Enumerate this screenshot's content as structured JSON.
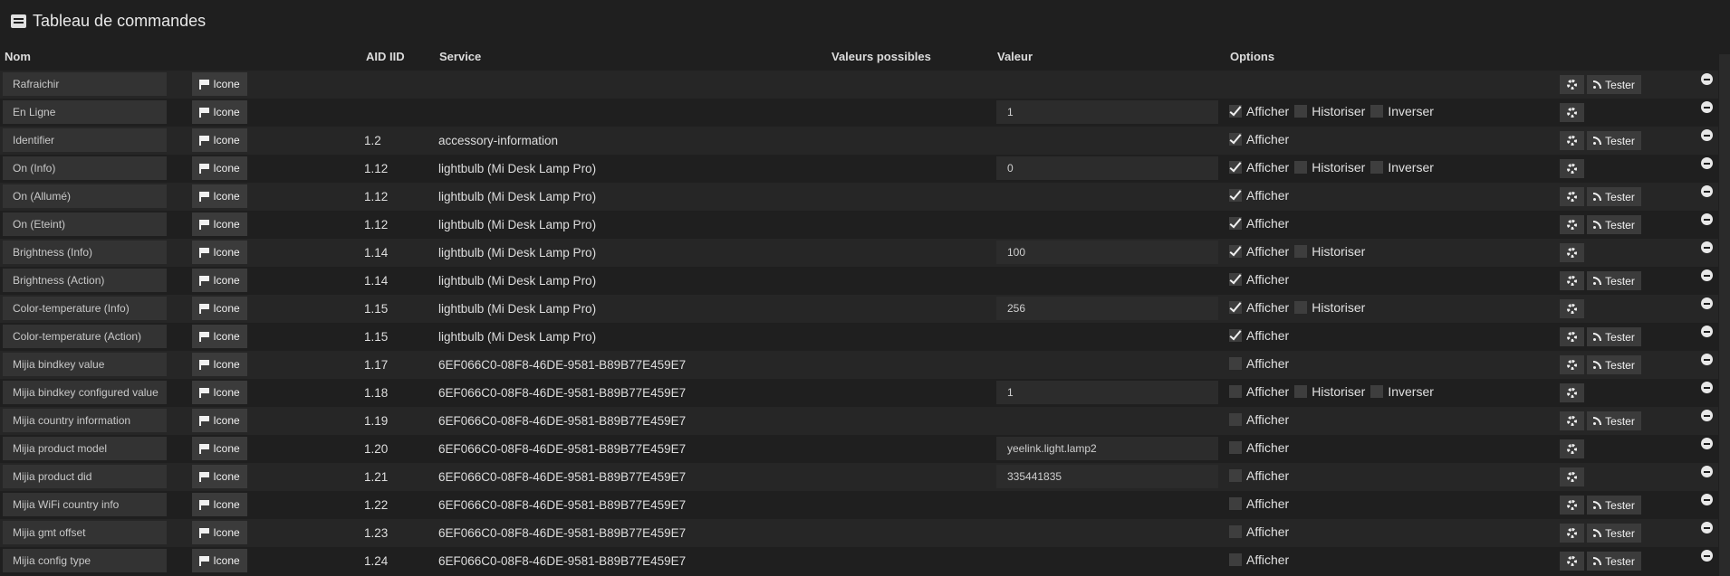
{
  "page": {
    "title": "Tableau de commandes",
    "title_icon": "list-icon"
  },
  "columns": {
    "name": "Nom",
    "aid": "AID IID",
    "service": "Service",
    "possible": "Valeurs possibles",
    "value": "Valeur",
    "options": "Options"
  },
  "labels": {
    "icon_button": "Icone",
    "test_button": "Tester",
    "afficher": "Afficher",
    "historiser": "Historiser",
    "inverser": "Inverser"
  },
  "rows": [
    {
      "name": "Rafraichir",
      "aid": "",
      "service": "",
      "value": null,
      "afficher": null,
      "historiser": null,
      "inverser": null,
      "test": true
    },
    {
      "name": "En Ligne",
      "aid": "",
      "service": "",
      "value": "1",
      "afficher": true,
      "historiser": false,
      "inverser": false,
      "test": false
    },
    {
      "name": "Identifier",
      "aid": "1.2",
      "service": "accessory-information",
      "value": null,
      "afficher": true,
      "historiser": null,
      "inverser": null,
      "test": true
    },
    {
      "name": "On (Info)",
      "aid": "1.12",
      "service": "lightbulb (Mi Desk Lamp Pro)",
      "value": "0",
      "afficher": true,
      "historiser": false,
      "inverser": false,
      "test": false
    },
    {
      "name": "On (Allumé)",
      "aid": "1.12",
      "service": "lightbulb (Mi Desk Lamp Pro)",
      "value": null,
      "afficher": true,
      "historiser": null,
      "inverser": null,
      "test": true
    },
    {
      "name": "On (Eteint)",
      "aid": "1.12",
      "service": "lightbulb (Mi Desk Lamp Pro)",
      "value": null,
      "afficher": true,
      "historiser": null,
      "inverser": null,
      "test": true
    },
    {
      "name": "Brightness (Info)",
      "aid": "1.14",
      "service": "lightbulb (Mi Desk Lamp Pro)",
      "value": "100",
      "afficher": true,
      "historiser": false,
      "inverser": null,
      "test": false
    },
    {
      "name": "Brightness (Action)",
      "aid": "1.14",
      "service": "lightbulb (Mi Desk Lamp Pro)",
      "value": null,
      "afficher": true,
      "historiser": null,
      "inverser": null,
      "test": true
    },
    {
      "name": "Color-temperature (Info)",
      "aid": "1.15",
      "service": "lightbulb (Mi Desk Lamp Pro)",
      "value": "256",
      "afficher": true,
      "historiser": false,
      "inverser": null,
      "test": false
    },
    {
      "name": "Color-temperature (Action)",
      "aid": "1.15",
      "service": "lightbulb (Mi Desk Lamp Pro)",
      "value": null,
      "afficher": true,
      "historiser": null,
      "inverser": null,
      "test": true
    },
    {
      "name": "Mijia bindkey value",
      "aid": "1.17",
      "service": "6EF066C0-08F8-46DE-9581-B89B77E459E7",
      "value": null,
      "afficher": false,
      "historiser": null,
      "inverser": null,
      "test": true
    },
    {
      "name": "Mijia bindkey configured value",
      "aid": "1.18",
      "service": "6EF066C0-08F8-46DE-9581-B89B77E459E7",
      "value": "1",
      "afficher": false,
      "historiser": false,
      "inverser": false,
      "test": false
    },
    {
      "name": "Mijia country information",
      "aid": "1.19",
      "service": "6EF066C0-08F8-46DE-9581-B89B77E459E7",
      "value": null,
      "afficher": false,
      "historiser": null,
      "inverser": null,
      "test": true
    },
    {
      "name": "Mijia product model",
      "aid": "1.20",
      "service": "6EF066C0-08F8-46DE-9581-B89B77E459E7",
      "value": "yeelink.light.lamp2",
      "afficher": false,
      "historiser": null,
      "inverser": null,
      "test": false
    },
    {
      "name": "Mijia product did",
      "aid": "1.21",
      "service": "6EF066C0-08F8-46DE-9581-B89B77E459E7",
      "value": "335441835",
      "afficher": false,
      "historiser": null,
      "inverser": null,
      "test": false
    },
    {
      "name": "Mijia WiFi country info",
      "aid": "1.22",
      "service": "6EF066C0-08F8-46DE-9581-B89B77E459E7",
      "value": null,
      "afficher": false,
      "historiser": null,
      "inverser": null,
      "test": true
    },
    {
      "name": "Mijia gmt offset",
      "aid": "1.23",
      "service": "6EF066C0-08F8-46DE-9581-B89B77E459E7",
      "value": null,
      "afficher": false,
      "historiser": null,
      "inverser": null,
      "test": true
    },
    {
      "name": "Mijia config type",
      "aid": "1.24",
      "service": "6EF066C0-08F8-46DE-9581-B89B77E459E7",
      "value": null,
      "afficher": false,
      "historiser": null,
      "inverser": null,
      "test": true
    }
  ]
}
